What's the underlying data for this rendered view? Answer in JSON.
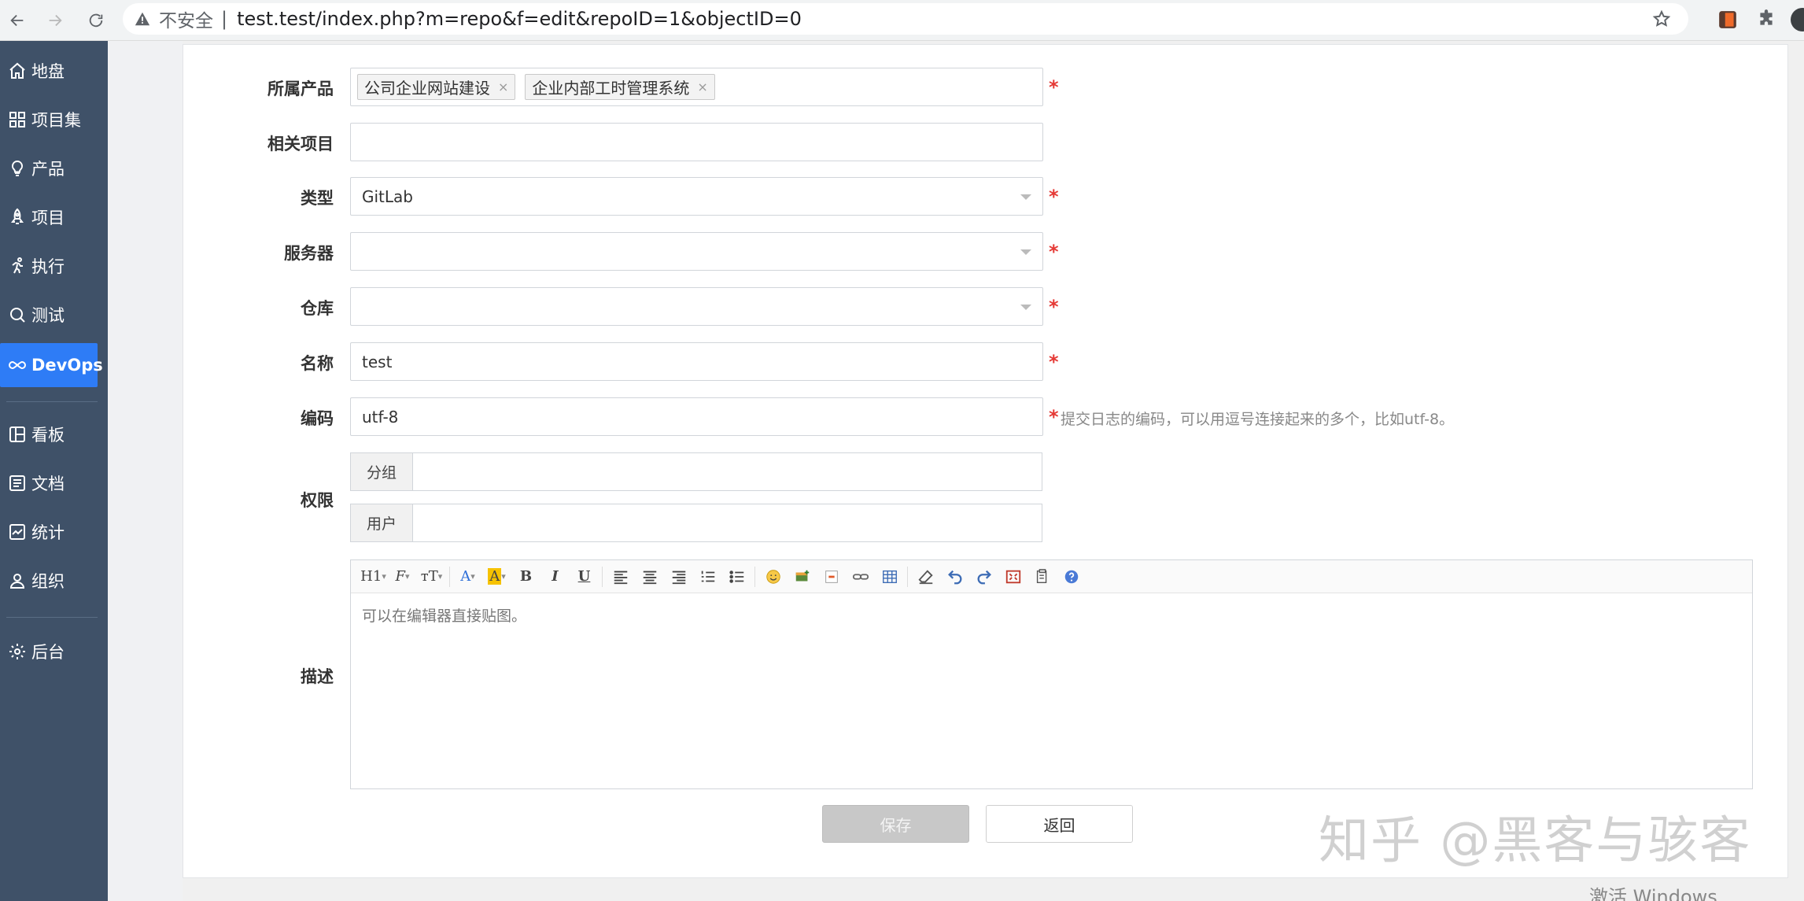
{
  "browser": {
    "security_label": "不安全",
    "separator": "|",
    "url": "test.test/index.php?m=repo&f=edit&repoID=1&objectID=0"
  },
  "sidebar": {
    "items": [
      {
        "label": "地盘",
        "icon": "home-icon"
      },
      {
        "label": "项目集",
        "icon": "grid-icon"
      },
      {
        "label": "产品",
        "icon": "lightbulb-icon"
      },
      {
        "label": "项目",
        "icon": "rocket-icon"
      },
      {
        "label": "执行",
        "icon": "runner-icon"
      },
      {
        "label": "测试",
        "icon": "search-icon"
      },
      {
        "label": "DevOps",
        "icon": "infinity-icon",
        "active": true
      },
      {
        "label": "看板",
        "icon": "kanban-icon"
      },
      {
        "label": "文档",
        "icon": "document-icon"
      },
      {
        "label": "统计",
        "icon": "chart-icon"
      },
      {
        "label": "组织",
        "icon": "user-icon"
      },
      {
        "label": "后台",
        "icon": "gear-icon"
      }
    ]
  },
  "form": {
    "product": {
      "label": "所属产品",
      "chips": [
        "公司企业网站建设",
        "企业内部工时管理系统"
      ],
      "chip_remove": "×"
    },
    "project": {
      "label": "相关项目",
      "value": ""
    },
    "type": {
      "label": "类型",
      "value": "GitLab"
    },
    "server": {
      "label": "服务器",
      "value": ""
    },
    "repo": {
      "label": "仓库",
      "value": ""
    },
    "name": {
      "label": "名称",
      "value": "test"
    },
    "encoding": {
      "label": "编码",
      "value": "utf-8",
      "hint": "提交日志的编码，可以用逗号连接起来的多个，比如utf-8。"
    },
    "acl": {
      "label": "权限",
      "group_addon": "分组",
      "user_addon": "用户",
      "group_value": "",
      "user_value": ""
    },
    "desc": {
      "label": "描述",
      "placeholder": "可以在编辑器直接贴图。"
    },
    "required_mark": "*"
  },
  "toolbar": {
    "h1": "H1",
    "font": "F",
    "size": "тT",
    "color": "A",
    "bg": "A",
    "bold": "B",
    "italic": "I",
    "underline": "U"
  },
  "buttons": {
    "save": "保存",
    "back": "返回"
  },
  "watermark": "知乎 @黑客与骇客",
  "os_notice": "激活 Windows",
  "colors": {
    "sidebar_bg": "#3f5168",
    "active": "#2e7cf6",
    "required": "#e53935"
  }
}
